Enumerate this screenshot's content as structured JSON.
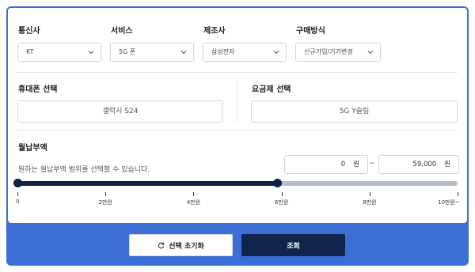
{
  "filters": {
    "carrier": {
      "label": "통신사",
      "value": "KT"
    },
    "service": {
      "label": "서비스",
      "value": "5G 폰"
    },
    "maker": {
      "label": "제조사",
      "value": "삼성전자"
    },
    "purchase": {
      "label": "구매방식",
      "value": "신규가입/기기변경"
    }
  },
  "phone": {
    "label": "휴대폰 선택",
    "value": "갤럭시 S24"
  },
  "plan": {
    "label": "요금제 선택",
    "value": "5G Y슬림"
  },
  "monthly": {
    "label": "월납부액",
    "hint": "원하는 월납부액 범위를 선택할 수 있습니다.",
    "min_value": "0",
    "max_value": "59,000",
    "unit": "원",
    "separator": "~",
    "range_fraction": [
      0,
      0.59
    ],
    "ticks": [
      "0",
      "2만원",
      "4만원",
      "6만원",
      "8만원",
      "10만원~"
    ]
  },
  "buttons": {
    "reset": "선택 초기화",
    "search": "조회"
  },
  "colors": {
    "frame": "#3b6fd6",
    "slider_active": "#0f2247",
    "slider_inactive": "#b4bcc6",
    "search_button": "#11254c"
  },
  "icons": {
    "reset": "refresh-icon",
    "dropdown": "chevron-down-icon"
  }
}
